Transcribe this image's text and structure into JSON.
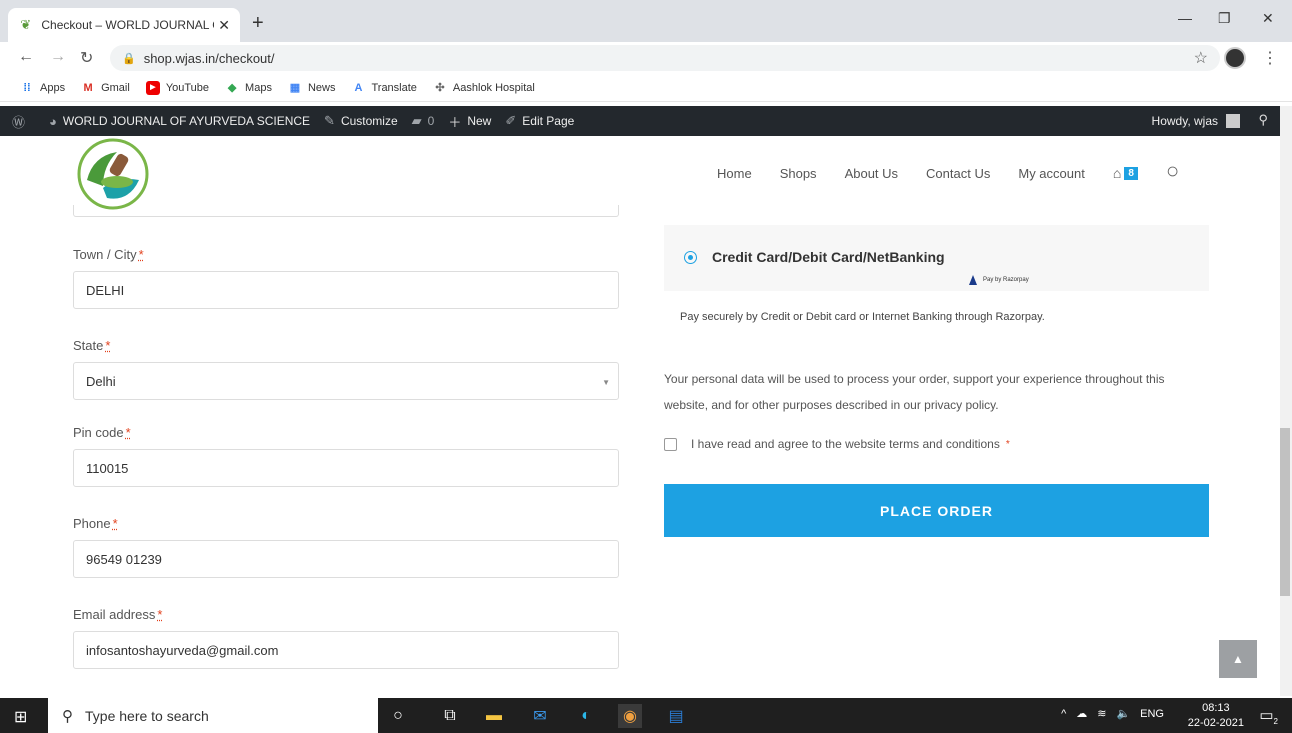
{
  "browser": {
    "tab_title": "Checkout – WORLD JOURNAL OF",
    "url": "shop.wjas.in/checkout/",
    "bookmarks": [
      "Apps",
      "Gmail",
      "YouTube",
      "Maps",
      "News",
      "Translate",
      "Aashlok Hospital"
    ]
  },
  "adminbar": {
    "site_name": "WORLD JOURNAL OF AYURVEDA SCIENCE",
    "customize": "Customize",
    "comments": "0",
    "new": "New",
    "edit_page": "Edit Page",
    "howdy": "Howdy, wjas"
  },
  "nav": {
    "items": [
      "Home",
      "Shops",
      "About Us",
      "Contact Us",
      "My account"
    ],
    "cart_count": "8"
  },
  "form": {
    "required_mark": "*",
    "town": {
      "label": "Town / City",
      "value": "DELHI"
    },
    "state": {
      "label": "State",
      "value": "Delhi"
    },
    "pin": {
      "label": "Pin code",
      "value": "110015"
    },
    "phone": {
      "label": "Phone",
      "value": "96549 01239"
    },
    "email": {
      "label": "Email address",
      "value": "infosantoshayurveda@gmail.com"
    }
  },
  "payment": {
    "method_title": "Credit Card/Debit Card/NetBanking",
    "razorpay_label": "Pay by Razorpay",
    "description": "Pay securely by Credit or Debit card or Internet Banking through Razorpay.",
    "privacy_text": "Your personal data will be used to process your order, support your experience throughout this website, and for other purposes described in our privacy policy.",
    "terms_text": "I have read and agree to the website terms and conditions",
    "place_order": "PLACE ORDER"
  },
  "taskbar": {
    "search_placeholder": "Type here to search",
    "lang": "ENG",
    "time": "08:13",
    "date": "22-02-2021",
    "notifications": "2"
  },
  "colors": {
    "accent": "#1da1e2",
    "adminbar": "#23282d"
  }
}
